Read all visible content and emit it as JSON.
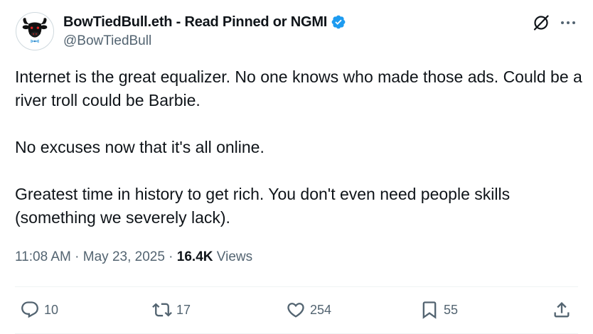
{
  "author": {
    "display_name": "BowTiedBull.eth - Read Pinned or NGMI",
    "handle": "@BowTiedBull",
    "verified": true,
    "avatar_icon": "bull-head-icon"
  },
  "tweet": {
    "paragraphs": [
      "Internet is the great equalizer. No one knows who made those ads. Could be a river troll could be Barbie.",
      "No excuses now that it's all online.",
      "Greatest time in history to get rich. You don't even need people skills (something we severely lack)."
    ]
  },
  "meta": {
    "time": "11:08 AM",
    "separator1": " · ",
    "date": "May 23, 2025",
    "separator2": " · ",
    "views_count": "16.4K",
    "views_label": " Views"
  },
  "actions": {
    "reply_count": "10",
    "retweet_count": "17",
    "like_count": "254",
    "bookmark_count": "55"
  },
  "colors": {
    "text_primary": "#0f1419",
    "text_secondary": "#536471",
    "verified_blue": "#1d9bf0",
    "divider": "#eff3f4"
  },
  "icons": {
    "header": [
      "grok-icon",
      "more-icon"
    ],
    "actions": [
      "reply-icon",
      "retweet-icon",
      "like-icon",
      "bookmark-icon",
      "share-icon"
    ]
  }
}
